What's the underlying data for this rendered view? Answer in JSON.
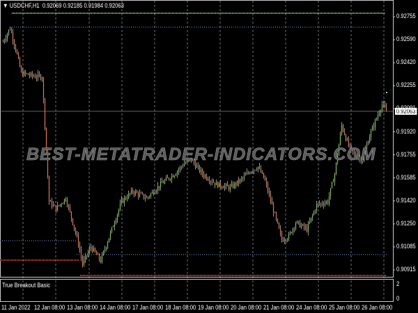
{
  "header": {
    "symbol_label": "USDCHF,H1",
    "ohlc": "0.92069 0.92185 0.91984 0.92063"
  },
  "indicator": {
    "name": "True Breakout Basic",
    "scale_top": "2",
    "scale_bottom": "0"
  },
  "watermark": "BEST-METATRADER-INDICATORS.COM",
  "current_price": "0.92063",
  "price_axis": [
    "0.92755",
    "0.92590",
    "0.92420",
    "0.92255",
    "0.92091",
    "0.91920",
    "0.91755",
    "0.91585",
    "0.91420",
    "0.91250",
    "0.91085",
    "0.90915"
  ],
  "time_axis": [
    "11 Jan 2022",
    "12 Jan 08:00",
    "13 Jan 08:00",
    "14 Jan 08:00",
    "17 Jan 08:00",
    "18 Jan 08:00",
    "19 Jan 08:00",
    "20 Jan 08:00",
    "21 Jan 08:00",
    "24 Jan 08:00",
    "25 Jan 08:00",
    "26 Jan 08:00"
  ],
  "colors": {
    "bull": "#7ec850",
    "bear": "#e07a50",
    "neutral": "#c8c8c8",
    "grid": "#c0c0c0",
    "green_level": "#8fdf8f",
    "blue_level": "#7aa0d8",
    "red_level": "#ff4a3a"
  },
  "chart_data": {
    "type": "candlestick",
    "ylim": [
      0.9085,
      0.928
    ],
    "path": [
      [
        2,
        0.92573
      ],
      [
        7,
        0.92674
      ],
      [
        11,
        0.92523
      ],
      [
        15,
        0.92346
      ],
      [
        25,
        0.92321
      ],
      [
        30,
        0.92321
      ],
      [
        32,
        0.91967
      ],
      [
        35,
        0.91412
      ],
      [
        40,
        0.91361
      ],
      [
        47,
        0.91437
      ],
      [
        52,
        0.9126
      ],
      [
        56,
        0.91109
      ],
      [
        59,
        0.90957
      ],
      [
        65,
        0.91083
      ],
      [
        72,
        0.90982
      ],
      [
        80,
        0.9121
      ],
      [
        87,
        0.91412
      ],
      [
        95,
        0.91487
      ],
      [
        105,
        0.91437
      ],
      [
        115,
        0.91538
      ],
      [
        125,
        0.91614
      ],
      [
        132,
        0.91689
      ],
      [
        137,
        0.91715
      ],
      [
        145,
        0.91614
      ],
      [
        155,
        0.91538
      ],
      [
        165,
        0.91513
      ],
      [
        172,
        0.91563
      ],
      [
        180,
        0.91639
      ],
      [
        185,
        0.91664
      ],
      [
        190,
        0.91563
      ],
      [
        197,
        0.91311
      ],
      [
        202,
        0.91134
      ],
      [
        207,
        0.91159
      ],
      [
        212,
        0.9126
      ],
      [
        220,
        0.9121
      ],
      [
        227,
        0.91386
      ],
      [
        235,
        0.91412
      ],
      [
        240,
        0.91614
      ],
      [
        245,
        0.91967
      ],
      [
        250,
        0.91816
      ],
      [
        255,
        0.9174
      ],
      [
        260,
        0.91715
      ],
      [
        265,
        0.91891
      ],
      [
        270,
        0.92018
      ],
      [
        274,
        0.92119
      ],
      [
        277,
        0.92068
      ]
    ],
    "levels": [
      0.9285,
      0.92755,
      0.91109,
      0.91008,
      0.90957,
      0.9084
    ]
  }
}
